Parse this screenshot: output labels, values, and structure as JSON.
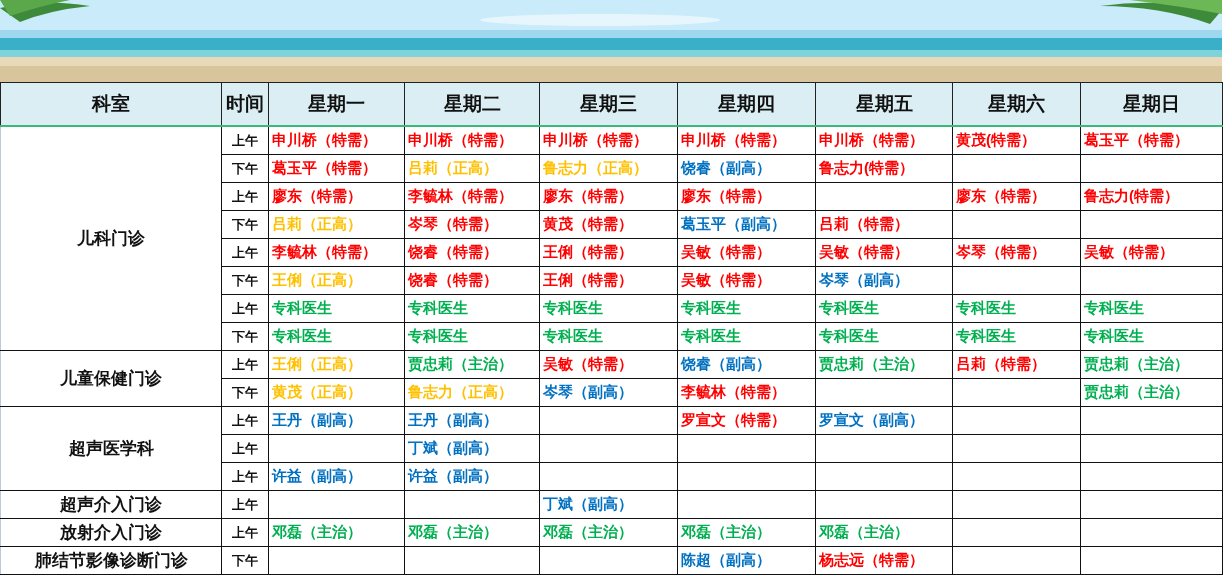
{
  "table": {
    "columns": [
      "科室",
      "时间",
      "星期一",
      "星期二",
      "星期三",
      "星期四",
      "星期五",
      "星期六",
      "星期日"
    ],
    "departments": [
      {
        "name": "儿科门诊",
        "rows": [
          {
            "time": "上午",
            "cells": [
              {
                "text": "申川桥（特需）",
                "color": "#ff0000"
              },
              {
                "text": "申川桥（特需）",
                "color": "#ff0000"
              },
              {
                "text": "申川桥（特需）",
                "color": "#ff0000"
              },
              {
                "text": "申川桥（特需）",
                "color": "#ff0000"
              },
              {
                "text": "申川桥（特需）",
                "color": "#ff0000"
              },
              {
                "text": "黄茂(特需）",
                "color": "#ff0000"
              },
              {
                "text": "葛玉平（特需）",
                "color": "#ff0000"
              }
            ]
          },
          {
            "time": "下午",
            "cells": [
              {
                "text": "葛玉平（特需）",
                "color": "#ff0000"
              },
              {
                "text": "吕莉（正高）",
                "color": "#ffc000"
              },
              {
                "text": "鲁志力（正高）",
                "color": "#ffc000"
              },
              {
                "text": "饶睿（副高）",
                "color": "#0070c0"
              },
              {
                "text": "鲁志力(特需）",
                "color": "#ff0000"
              },
              null,
              null
            ]
          },
          {
            "time": "上午",
            "cells": [
              {
                "text": "廖东（特需）",
                "color": "#ff0000"
              },
              {
                "text": "李毓林（特需）",
                "color": "#ff0000"
              },
              {
                "text": "廖东（特需）",
                "color": "#ff0000"
              },
              {
                "text": "廖东（特需）",
                "color": "#ff0000"
              },
              null,
              {
                "text": "廖东（特需）",
                "color": "#ff0000"
              },
              {
                "text": "鲁志力(特需）",
                "color": "#ff0000"
              }
            ]
          },
          {
            "time": "下午",
            "cells": [
              {
                "text": "吕莉（正高）",
                "color": "#ffc000"
              },
              {
                "text": "岑琴（特需）",
                "color": "#ff0000"
              },
              {
                "text": "黄茂（特需）",
                "color": "#ff0000"
              },
              {
                "text": "葛玉平（副高）",
                "color": "#0070c0"
              },
              {
                "text": "吕莉（特需）",
                "color": "#ff0000"
              },
              null,
              null
            ]
          },
          {
            "time": "上午",
            "cells": [
              {
                "text": "李毓林（特需）",
                "color": "#ff0000"
              },
              {
                "text": "饶睿（特需）",
                "color": "#ff0000"
              },
              {
                "text": "王俐（特需）",
                "color": "#ff0000"
              },
              {
                "text": "吴敏（特需）",
                "color": "#ff0000"
              },
              {
                "text": "吴敏（特需）",
                "color": "#ff0000"
              },
              {
                "text": "岑琴（特需）",
                "color": "#ff0000"
              },
              {
                "text": "吴敏（特需）",
                "color": "#ff0000"
              }
            ]
          },
          {
            "time": "下午",
            "cells": [
              {
                "text": "王俐（正高）",
                "color": "#ffc000"
              },
              {
                "text": "饶睿（特需）",
                "color": "#ff0000"
              },
              {
                "text": "王俐（特需）",
                "color": "#ff0000"
              },
              {
                "text": "吴敏（特需）",
                "color": "#ff0000"
              },
              {
                "text": "岑琴（副高）",
                "color": "#0070c0"
              },
              null,
              null
            ]
          },
          {
            "time": "上午",
            "cells": [
              {
                "text": "专科医生",
                "color": "#00b050"
              },
              {
                "text": "专科医生",
                "color": "#00b050"
              },
              {
                "text": "专科医生",
                "color": "#00b050"
              },
              {
                "text": "专科医生",
                "color": "#00b050"
              },
              {
                "text": "专科医生",
                "color": "#00b050"
              },
              {
                "text": "专科医生",
                "color": "#00b050"
              },
              {
                "text": "专科医生",
                "color": "#00b050"
              }
            ]
          },
          {
            "time": "下午",
            "cells": [
              {
                "text": "专科医生",
                "color": "#00b050"
              },
              {
                "text": "专科医生",
                "color": "#00b050"
              },
              {
                "text": "专科医生",
                "color": "#00b050"
              },
              {
                "text": "专科医生",
                "color": "#00b050"
              },
              {
                "text": "专科医生",
                "color": "#00b050"
              },
              {
                "text": "专科医生",
                "color": "#00b050"
              },
              {
                "text": "专科医生",
                "color": "#00b050"
              }
            ]
          }
        ]
      },
      {
        "name": "儿童保健门诊",
        "rows": [
          {
            "time": "上午",
            "cells": [
              {
                "text": "王俐（正高）",
                "color": "#ffc000"
              },
              {
                "text": "贾忠莉（主治）",
                "color": "#00b050"
              },
              {
                "text": "吴敏（特需）",
                "color": "#ff0000"
              },
              {
                "text": "饶睿（副高）",
                "color": "#0070c0"
              },
              {
                "text": "贾忠莉（主治）",
                "color": "#00b050"
              },
              {
                "text": "吕莉（特需）",
                "color": "#ff0000"
              },
              {
                "text": "贾忠莉（主治）",
                "color": "#00b050"
              }
            ]
          },
          {
            "time": "下午",
            "cells": [
              {
                "text": "黄茂（正高）",
                "color": "#ffc000"
              },
              {
                "text": "鲁志力（正高）",
                "color": "#ffc000"
              },
              {
                "text": "岑琴（副高）",
                "color": "#0070c0"
              },
              {
                "text": "李毓林（特需）",
                "color": "#ff0000"
              },
              null,
              null,
              {
                "text": "贾忠莉（主治）",
                "color": "#00b050"
              }
            ]
          }
        ]
      },
      {
        "name": "超声医学科",
        "rows": [
          {
            "time": "上午",
            "cells": [
              {
                "text": "王丹（副高）",
                "color": "#0070c0"
              },
              {
                "text": "王丹（副高）",
                "color": "#0070c0"
              },
              null,
              {
                "text": "罗宣文（特需）",
                "color": "#ff0000"
              },
              {
                "text": "罗宣文（副高）",
                "color": "#0070c0"
              },
              null,
              null
            ]
          },
          {
            "time": "上午",
            "cells": [
              null,
              {
                "text": "丁斌（副高）",
                "color": "#0070c0"
              },
              null,
              null,
              null,
              null,
              null
            ]
          },
          {
            "time": "上午",
            "cells": [
              {
                "text": "许益（副高）",
                "color": "#0070c0"
              },
              {
                "text": "许益（副高）",
                "color": "#0070c0"
              },
              null,
              null,
              null,
              null,
              null
            ]
          }
        ]
      },
      {
        "name": "超声介入门诊",
        "rows": [
          {
            "time": "上午",
            "cells": [
              null,
              null,
              {
                "text": "丁斌（副高）",
                "color": "#0070c0"
              },
              null,
              null,
              null,
              null
            ]
          }
        ]
      },
      {
        "name": "放射介入门诊",
        "rows": [
          {
            "time": "上午",
            "cells": [
              {
                "text": "邓磊（主治）",
                "color": "#00b050"
              },
              {
                "text": "邓磊（主治）",
                "color": "#00b050"
              },
              {
                "text": "邓磊（主治）",
                "color": "#00b050"
              },
              {
                "text": "邓磊（主治）",
                "color": "#00b050"
              },
              {
                "text": "邓磊（主治）",
                "color": "#00b050"
              },
              null,
              null
            ]
          }
        ]
      },
      {
        "name": "肺结节影像诊断门诊",
        "rows": [
          {
            "time": "下午",
            "cells": [
              null,
              null,
              null,
              {
                "text": "陈超（副高）",
                "color": "#0070c0"
              },
              {
                "text": "杨志远（特需）",
                "color": "#ff0000"
              },
              null,
              null
            ]
          }
        ]
      }
    ]
  }
}
